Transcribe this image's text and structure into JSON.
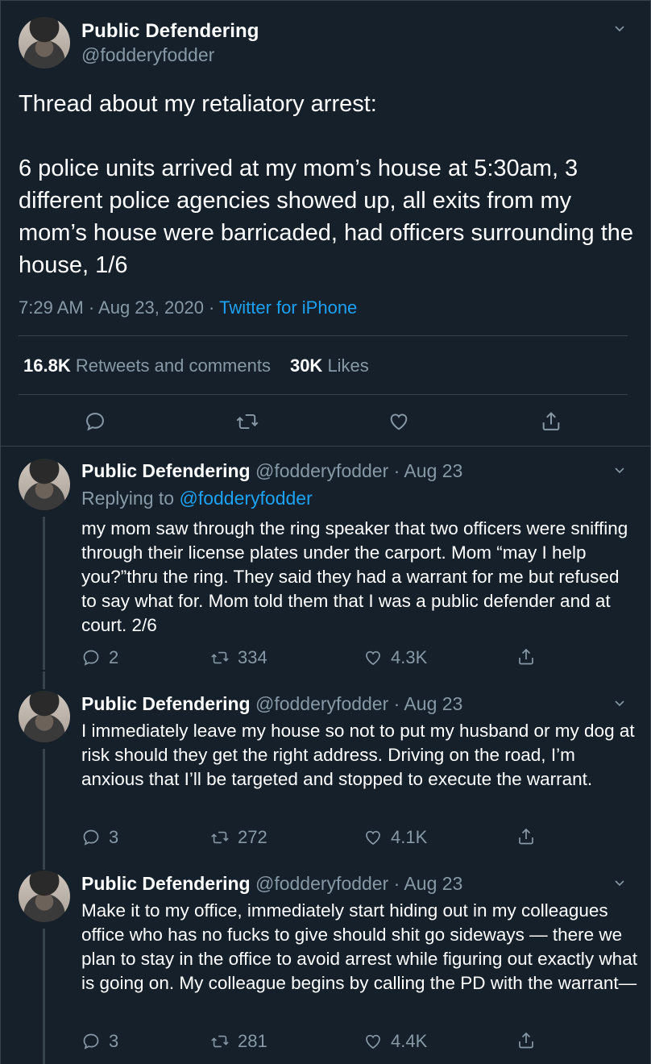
{
  "main_tweet": {
    "name": "Public Defendering",
    "handle": "@fodderyfodder",
    "text": "Thread about my retaliatory arrest:\n\n6 police units arrived at my mom’s house at 5:30am, 3 different police agencies showed up, all exits from my mom’s house were barricaded, had officers surrounding the house, 1/6",
    "time": "7:29 AM · Aug 23, 2020 · ",
    "source": "Twitter for iPhone",
    "retweets_count": "16.8K",
    "retweets_label": "Retweets and comments",
    "likes_count": "30K",
    "likes_label": "Likes"
  },
  "replies": [
    {
      "name": "Public Defendering",
      "meta": " @fodderyfodder · Aug 23",
      "replying_prefix": "Replying to ",
      "replying_to": "@fodderyfodder",
      "text": "my mom saw through the ring speaker that two officers were sniffing through their license plates under the carport. Mom “may I help you?”thru the ring. They said they had a warrant for me but refused to say what for. Mom told them that I was a public defender and at court. 2/6",
      "replies": "2",
      "retweets": "334",
      "likes": "4.3K"
    },
    {
      "name": "Public Defendering",
      "meta": " @fodderyfodder · Aug 23",
      "text": "I immediately leave my house so not to put my husband or my dog at risk should they get the right address. Driving on the road, I’m anxious that I’ll be targeted and stopped to execute the warrant.",
      "replies": "3",
      "retweets": "272",
      "likes": "4.1K"
    },
    {
      "name": "Public Defendering",
      "meta": " @fodderyfodder · Aug 23",
      "text": "Make it to my office, immediately start hiding out in my colleagues office who has no fucks to give should shit go sideways — there we plan to stay in the office to avoid arrest while figuring out exactly what is going on. My colleague begins by calling the PD with the warrant—",
      "replies": "3",
      "retweets": "281",
      "likes": "4.4K"
    }
  ],
  "icons": {
    "reply": "reply-icon",
    "retweet": "retweet-icon",
    "like": "heart-icon",
    "share": "share-icon",
    "caret": "chevron-down-icon"
  },
  "colors": {
    "background": "#15202b",
    "secondary_text": "#8899a6",
    "link": "#1da1f2",
    "border": "#38444d"
  }
}
